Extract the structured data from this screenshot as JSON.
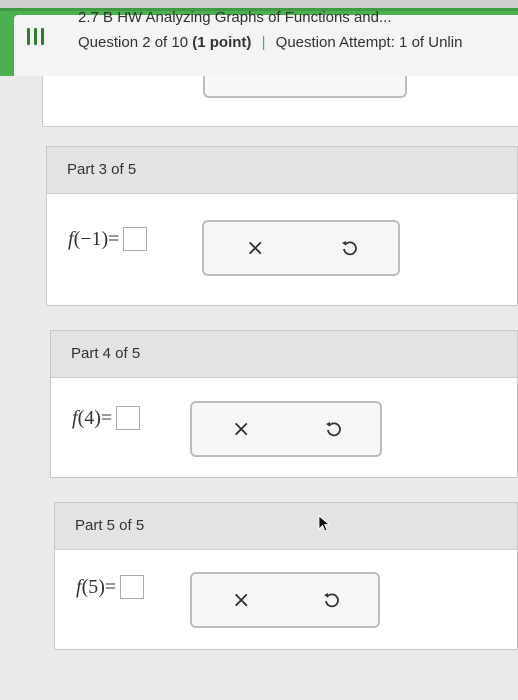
{
  "header": {
    "title": "2.7 B HW Analyzing Graphs of Functions and...",
    "question": "Question 2 of 10",
    "points": "(1 point)",
    "separator": "|",
    "attempt": "Question Attempt: 1 of Unlin"
  },
  "parts": [
    {
      "label": "Part 3 of 5",
      "fn": "f",
      "arg": "(−1)",
      "eq": "=",
      "clear_icon": "×",
      "undo_icon": "undo-icon"
    },
    {
      "label": "Part 4 of 5",
      "fn": "f",
      "arg": "(4)",
      "eq": "=",
      "clear_icon": "×",
      "undo_icon": "undo-icon"
    },
    {
      "label": "Part 5 of 5",
      "fn": "f",
      "arg": "(5)",
      "eq": "=",
      "clear_icon": "×",
      "undo_icon": "undo-icon"
    }
  ],
  "colors": {
    "accent": "#4caf50",
    "header_bg": "#f4f4f4",
    "part_head_bg": "#e3e3e3"
  }
}
